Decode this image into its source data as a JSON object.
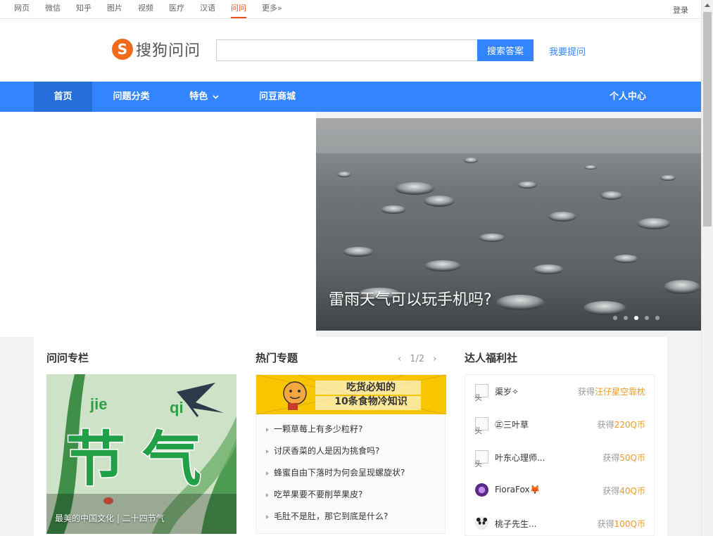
{
  "topbar": {
    "links": [
      "网页",
      "微信",
      "知乎",
      "图片",
      "视频",
      "医疗",
      "汉语",
      "问问",
      "更多»"
    ],
    "active": "问问",
    "login": "登录"
  },
  "header": {
    "logo_mark": "S",
    "logo_text": "搜狗问问",
    "search_value": "",
    "search_button": "搜索答案",
    "ask_link": "我要提问"
  },
  "nav": {
    "home": "首页",
    "categories": "问题分类",
    "featured": "特色",
    "shop": "问豆商城",
    "profile": "个人中心"
  },
  "hero": {
    "caption": "雷雨天气可以玩手机吗?",
    "dots": 5,
    "active_dot": 3
  },
  "column": {
    "title": "问问专栏",
    "card_word_1": "jie",
    "card_word_2": "qi",
    "card_big_1": "节",
    "card_big_2": "气",
    "caption": "最美的中国文化 | 二十四节气"
  },
  "hot": {
    "title": "热门专题",
    "prev": "‹",
    "page": "1/2",
    "next": "›",
    "banner_line1": "吃货必知的",
    "banner_line2": "10条食物冷知识",
    "items": [
      "一颗草莓上有多少粒籽?",
      "讨厌香菜的人是因为挑食吗?",
      "蜂蜜自由下落时为何会呈现螺旋状?",
      "吃苹果要不要削苹果皮?",
      "毛肚不是肚，那它到底是什么?"
    ]
  },
  "welfare": {
    "title": "达人福利社",
    "avatar_alt": "头",
    "rows": [
      {
        "name": "渠岁✧",
        "prefix": "获得",
        "prize": "汪仔星空靠枕"
      },
      {
        "name": "㊣三叶草",
        "prefix": "获得",
        "prize": "220Q币"
      },
      {
        "name": "叶东心理师...",
        "prefix": "获得",
        "prize": "50Q币"
      },
      {
        "name": "FioraFox🦊",
        "prefix": "获得",
        "prize": "40Q币"
      },
      {
        "name": "桃子先生...",
        "prefix": "获得",
        "prize": "100Q币"
      }
    ]
  }
}
